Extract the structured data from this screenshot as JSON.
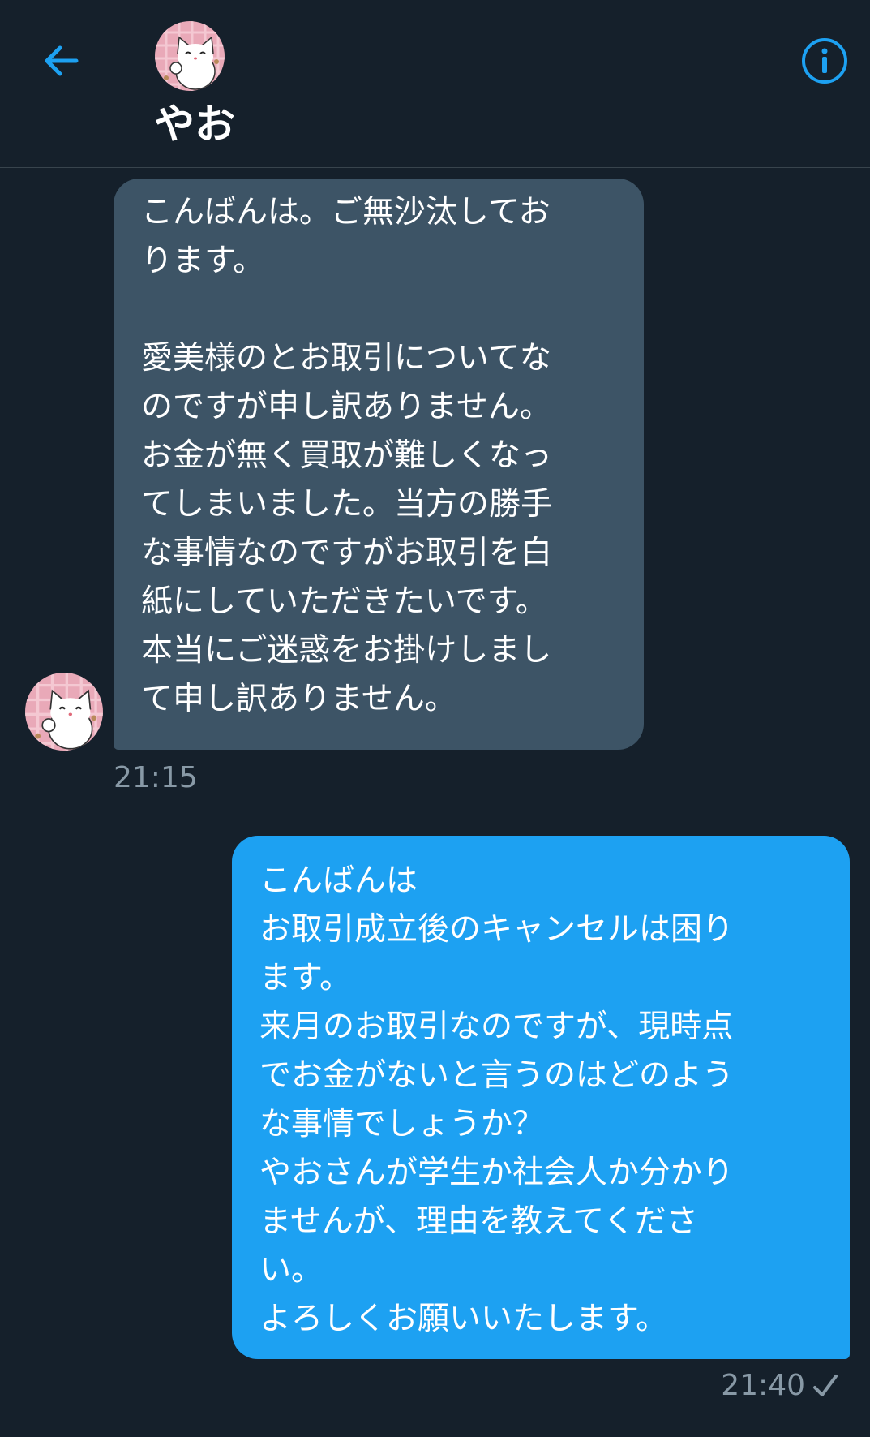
{
  "header": {
    "back_icon": "arrow-left-icon",
    "avatar_icon": "cat-avatar",
    "title": "やお",
    "info_icon": "info-circle-icon"
  },
  "colors": {
    "background": "#15202b",
    "accent": "#1da1f2",
    "received_bubble": "#3d5466",
    "muted_text": "#8899a6",
    "divider": "#38444d"
  },
  "messages": [
    {
      "direction": "received",
      "text": "こんばんは。ご無沙汰してお\nります。\n\n愛美様のとお取引についてな\nのですが申し訳ありません。\nお金が無く買取が難しくなっ\nてしまいました。当方の勝手\nな事情なのですがお取引を白\n紙にしていただきたいです。\n本当にご迷惑をお掛けしまし\nて申し訳ありません。",
      "time": "21:15"
    },
    {
      "direction": "sent",
      "text": "こんばんは\nお取引成立後のキャンセルは困り\nます。\n来月のお取引なのですが、現時点\nでお金がないと言うのはどのよう\nな事情でしょうか？\nやおさんが学生か社会人か分かり\nませんが、理由を教えてくださ\nい。\nよろしくお願いいたします。",
      "time": "21:40",
      "status_icon": "sent-check-icon"
    }
  ]
}
